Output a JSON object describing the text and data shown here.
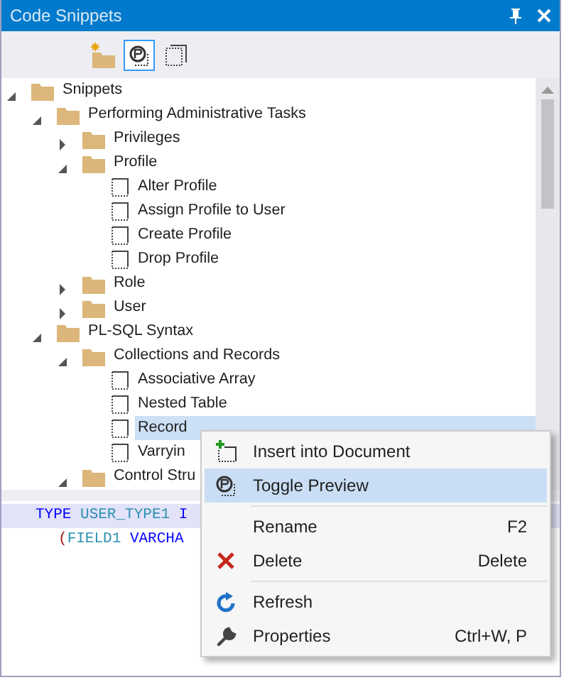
{
  "window": {
    "title": "Code Snippets"
  },
  "toolbar": [
    {
      "kind": "new-folder",
      "selected": false
    },
    {
      "kind": "preview",
      "selected": true
    },
    {
      "kind": "snippet",
      "selected": false
    }
  ],
  "tree": [
    {
      "label": "Snippets",
      "kind": "folder",
      "expanded": true,
      "selected": false,
      "children": [
        {
          "label": "Performing Administrative Tasks",
          "kind": "folder",
          "expanded": true,
          "selected": false,
          "children": [
            {
              "label": "Privileges",
              "kind": "folder",
              "expanded": false,
              "selected": false
            },
            {
              "label": "Profile",
              "kind": "folder",
              "expanded": true,
              "selected": false,
              "children": [
                {
                  "label": "Alter Profile",
                  "kind": "snippet",
                  "selected": false
                },
                {
                  "label": "Assign Profile to User",
                  "kind": "snippet",
                  "selected": false
                },
                {
                  "label": "Create Profile",
                  "kind": "snippet",
                  "selected": false
                },
                {
                  "label": "Drop Profile",
                  "kind": "snippet",
                  "selected": false
                }
              ]
            },
            {
              "label": "Role",
              "kind": "folder",
              "expanded": false,
              "selected": false
            },
            {
              "label": "User",
              "kind": "folder",
              "expanded": false,
              "selected": false
            }
          ]
        },
        {
          "label": "PL-SQL Syntax",
          "kind": "folder",
          "expanded": true,
          "selected": false,
          "children": [
            {
              "label": "Collections and Records",
              "kind": "folder",
              "expanded": true,
              "selected": false,
              "children": [
                {
                  "label": "Associative Array",
                  "kind": "snippet",
                  "selected": false
                },
                {
                  "label": "Nested Table",
                  "kind": "snippet",
                  "selected": false
                },
                {
                  "label": "Record",
                  "kind": "snippet",
                  "selected": true
                },
                {
                  "label": "Varryin",
                  "kind": "snippet",
                  "selected": false
                }
              ]
            },
            {
              "label": "Control Stru",
              "kind": "folder",
              "expanded": true,
              "selected": false
            }
          ]
        }
      ]
    }
  ],
  "preview": {
    "lines": [
      {
        "selected": true,
        "tokens": [
          {
            "kind": "keyword",
            "text": "TYPE"
          },
          {
            "kind": "identifier",
            "text": "USER_TYPE1"
          },
          {
            "kind": "keyword",
            "text": "I"
          }
        ]
      },
      {
        "selected": false,
        "tokens": [
          {
            "kind": "punct",
            "text": "("
          },
          {
            "kind": "identifier",
            "text": "FIELD1"
          },
          {
            "kind": "keyword",
            "text": "VARCHA"
          }
        ]
      }
    ]
  },
  "context_menu": [
    {
      "kind": "insert",
      "label": "Insert into Document",
      "selected": false
    },
    {
      "kind": "preview",
      "label": "Toggle Preview",
      "selected": true
    },
    {
      "kind": "separator"
    },
    {
      "kind": "rename",
      "label": "Rename",
      "shortcut": "F2",
      "selected": false
    },
    {
      "kind": "delete",
      "label": "Delete",
      "shortcut": "Delete",
      "selected": false
    },
    {
      "kind": "separator"
    },
    {
      "kind": "refresh",
      "label": "Refresh",
      "selected": false
    },
    {
      "kind": "properties",
      "label": "Properties",
      "shortcut": "Ctrl+W, P",
      "selected": false
    }
  ]
}
